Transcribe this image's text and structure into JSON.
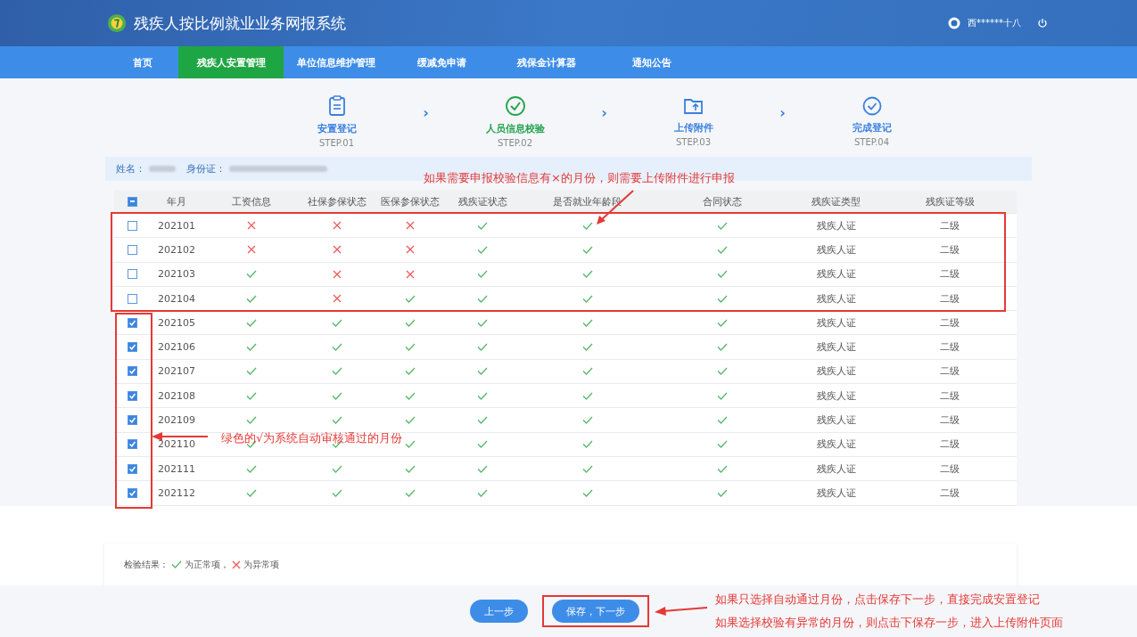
{
  "header": {
    "title": "残疾人按比例就业业务网报系统",
    "user": "西******十八"
  },
  "nav": [
    {
      "label": "首页",
      "selected": false
    },
    {
      "label": "残疾人安置管理",
      "selected": true
    },
    {
      "label": "单位信息维护管理",
      "selected": false
    },
    {
      "label": "缓减免申请",
      "selected": false
    },
    {
      "label": "残保金计算器",
      "selected": false
    },
    {
      "label": "通知公告",
      "selected": false
    }
  ],
  "steps": [
    {
      "kind": "clipboard",
      "label": "安置登记",
      "step": "STEP.01",
      "current": false
    },
    {
      "kind": "verify",
      "label": "人员信息校验",
      "step": "STEP.02",
      "current": true
    },
    {
      "kind": "upload",
      "label": "上传附件",
      "step": "STEP.03",
      "current": false
    },
    {
      "kind": "done",
      "label": "完成登记",
      "step": "STEP.04",
      "current": false
    }
  ],
  "step_separator": "›",
  "person": {
    "name_label": "姓名：",
    "id_label": "身份证："
  },
  "table": {
    "header_indeterminate": true,
    "columns": [
      "年月",
      "工资信息",
      "社保参保状态",
      "医保参保状态",
      "残疾证状态",
      "是否就业年龄段",
      "合同状态",
      "残疾证类型",
      "残疾证等级"
    ],
    "rows": [
      {
        "checked": false,
        "month": "202101",
        "checks": [
          false,
          false,
          false,
          true,
          true,
          true
        ],
        "card_type": "残疾人证",
        "card_level": "二级"
      },
      {
        "checked": false,
        "month": "202102",
        "checks": [
          false,
          false,
          false,
          true,
          true,
          true
        ],
        "card_type": "残疾人证",
        "card_level": "二级"
      },
      {
        "checked": false,
        "month": "202103",
        "checks": [
          true,
          false,
          false,
          true,
          true,
          true
        ],
        "card_type": "残疾人证",
        "card_level": "二级"
      },
      {
        "checked": false,
        "month": "202104",
        "checks": [
          true,
          false,
          true,
          true,
          true,
          true
        ],
        "card_type": "残疾人证",
        "card_level": "二级"
      },
      {
        "checked": true,
        "month": "202105",
        "checks": [
          true,
          true,
          true,
          true,
          true,
          true
        ],
        "card_type": "残疾人证",
        "card_level": "二级"
      },
      {
        "checked": true,
        "month": "202106",
        "checks": [
          true,
          true,
          true,
          true,
          true,
          true
        ],
        "card_type": "残疾人证",
        "card_level": "二级"
      },
      {
        "checked": true,
        "month": "202107",
        "checks": [
          true,
          true,
          true,
          true,
          true,
          true
        ],
        "card_type": "残疾人证",
        "card_level": "二级"
      },
      {
        "checked": true,
        "month": "202108",
        "checks": [
          true,
          true,
          true,
          true,
          true,
          true
        ],
        "card_type": "残疾人证",
        "card_level": "二级"
      },
      {
        "checked": true,
        "month": "202109",
        "checks": [
          true,
          true,
          true,
          true,
          true,
          true
        ],
        "card_type": "残疾人证",
        "card_level": "二级"
      },
      {
        "checked": true,
        "month": "202110",
        "checks": [
          true,
          true,
          true,
          true,
          true,
          true
        ],
        "card_type": "残疾人证",
        "card_level": "二级"
      },
      {
        "checked": true,
        "month": "202111",
        "checks": [
          true,
          true,
          true,
          true,
          true,
          true
        ],
        "card_type": "残疾人证",
        "card_level": "二级"
      },
      {
        "checked": true,
        "month": "202112",
        "checks": [
          true,
          true,
          true,
          true,
          true,
          true
        ],
        "card_type": "残疾人证",
        "card_level": "二级"
      }
    ]
  },
  "legend": {
    "label": "检验结果：",
    "ok_text": "为正常项，",
    "bad_text": "为异常项"
  },
  "buttons": [
    {
      "label": "上一步",
      "highlighted": false
    },
    {
      "label": "保存，下一步",
      "highlighted": true
    }
  ],
  "annotations": {
    "top": "如果需要申报校验信息有×的月份，则需要上传附件进行申报",
    "middle": "绿色的√为系统自动审核通过的月份",
    "bottom": [
      "如果只选择自动通过月份，点击保存下一步，直接完成安置登记",
      "如果选择校验有异常的月份，则点击下保存一步，进入上传附件页面"
    ]
  }
}
